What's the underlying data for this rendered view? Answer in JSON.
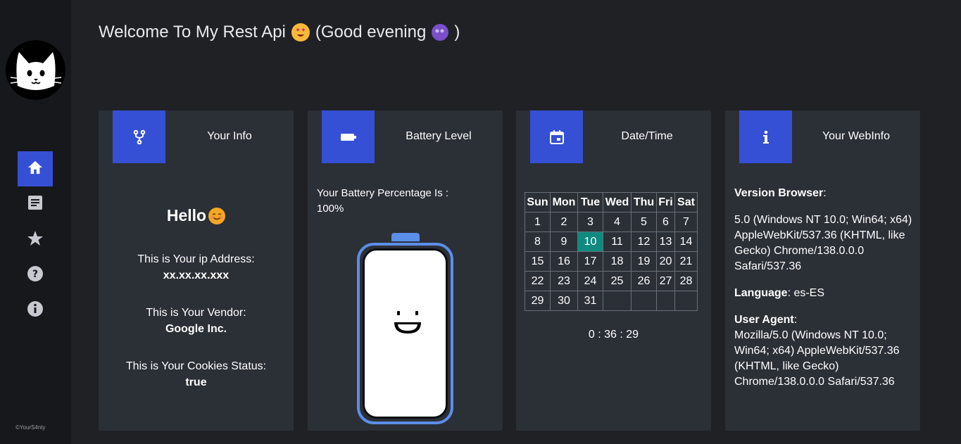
{
  "sidebar": {
    "logo_icon": "cat-face-icon",
    "items": [
      {
        "icon": "home-icon",
        "active": true
      },
      {
        "icon": "article-icon",
        "active": false
      },
      {
        "icon": "star-icon",
        "active": false
      },
      {
        "icon": "help-icon",
        "active": false
      },
      {
        "icon": "info-icon",
        "active": false
      }
    ],
    "copyright": "©YourS4nty"
  },
  "header": {
    "welcome_text": "Welcome To My Rest Api",
    "greeting_text": "(Good evening",
    "greeting_close": ")"
  },
  "cards": {
    "info": {
      "title": "Your Info",
      "icon": "fork-icon",
      "hello": "Hello",
      "ip_label": "This is Your ip Address:",
      "ip_value": "xx.xx.xx.xxx",
      "vendor_label": "This is Your Vendor:",
      "vendor_value": "Google Inc.",
      "cookies_label": "This is Your Cookies Status:",
      "cookies_value": "true"
    },
    "battery": {
      "title": "Battery Level",
      "icon": "battery-icon",
      "label": "Your Battery Percentage Is :",
      "value": "100%",
      "level": 1.0
    },
    "datetime": {
      "title": "Date/Time",
      "icon": "calendar-icon",
      "weekdays": [
        "Sun",
        "Mon",
        "Tue",
        "Wed",
        "Thu",
        "Fri",
        "Sat"
      ],
      "weeks": [
        [
          "1",
          "2",
          "3",
          "4",
          "5",
          "6",
          "7"
        ],
        [
          "8",
          "9",
          "10",
          "11",
          "12",
          "13",
          "14"
        ],
        [
          "15",
          "16",
          "17",
          "18",
          "19",
          "20",
          "21"
        ],
        [
          "22",
          "23",
          "24",
          "25",
          "26",
          "27",
          "28"
        ],
        [
          "29",
          "30",
          "31",
          "",
          "",
          "",
          ""
        ]
      ],
      "today": "10",
      "time": "0 : 36 : 29"
    },
    "webinfo": {
      "title": "Your WebInfo",
      "icon": "info-icon",
      "version_label": "Version Browser",
      "version_value": "5.0 (Windows NT 10.0; Win64; x64) AppleWebKit/537.36 (KHTML, like Gecko) Chrome/138.0.0.0 Safari/537.36",
      "language_label": "Language",
      "language_value": "es-ES",
      "agent_label": "User Agent",
      "agent_value": "Mozilla/5.0 (Windows NT 10.0; Win64; x64) AppleWebKit/537.36 (KHTML, like Gecko) Chrome/138.0.0.0 Safari/537.36"
    }
  },
  "colors": {
    "accent": "#3550d4",
    "today": "#0f8a7e",
    "battery_outline": "#5b8ee8"
  }
}
